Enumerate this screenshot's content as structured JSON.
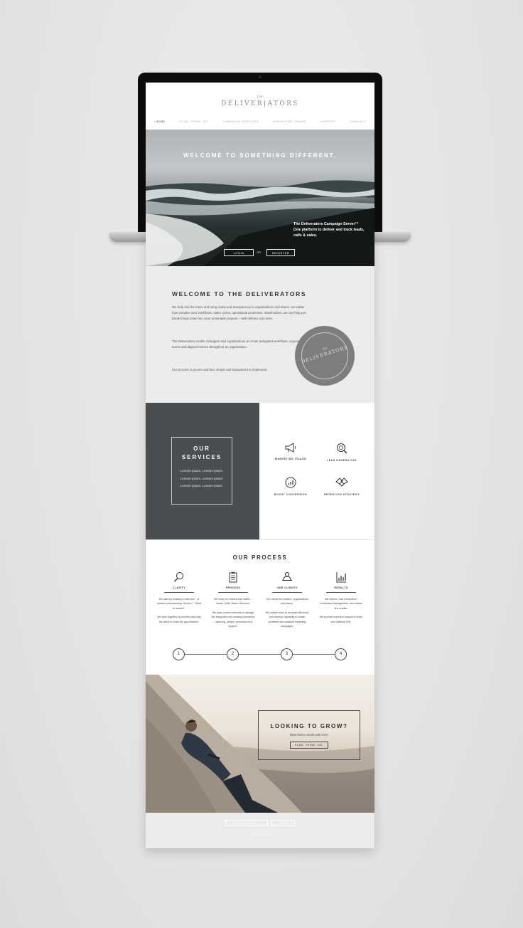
{
  "header": {
    "logo_prefix": "the",
    "logo": "DELIVER|ATORS",
    "nav": [
      "HOME",
      "PLAN. THINK. DO.",
      "CAMPAIGN SERVICES",
      "MARKETING TRIAGE",
      "SUPPORT",
      "CONTACT"
    ],
    "active_nav": "HOME"
  },
  "hero": {
    "title": "WELCOME TO SOMETHING DIFFERENT.",
    "tagline_title": "The Deliverators Campaign Server™",
    "tagline_body": "One platform to deliver and track leads, calls & sales.",
    "login_label": "LOGIN",
    "or_label": "OR",
    "register_label": "REGISTER"
  },
  "welcome": {
    "title": "WELCOME TO THE DELIVERATORS",
    "paragraphs": [
      "We help end the mess and bring clarity and transparency to organisations and teams. No matter how complex your workflows, sales cycles, operational processes, stakeholders, we can help you break things down into clear actionable projects – with defined outcomes.",
      "The Deliverators enable managers and organisations to create delegated workflows, empowered teams and aligned metrics throughout an organisation.",
      "Our process is proven and fast, simple and transparent to implement."
    ],
    "stamp_small": "the",
    "stamp_text": "DELIVERATORS"
  },
  "services": {
    "title_line1": "OUR",
    "title_line2": "SERVICES",
    "body": "Loreum ipsum. Loreum ipsum. Loreum ipsum. Loreum ipsum. Loreum ipsum. Loreum ipsum.",
    "items": [
      {
        "label": "MARKETING TRIAGE",
        "icon": "megaphone-icon"
      },
      {
        "label": "LEAD GENERATION",
        "icon": "target-search-icon"
      },
      {
        "label": "BOOST CONVERSION",
        "icon": "growth-chart-icon"
      },
      {
        "label": "RETENTION STRATEGY",
        "icon": "handshake-icon"
      }
    ]
  },
  "process": {
    "title": "OUR PROCESS",
    "columns": [
      {
        "label": "CLARITY",
        "icon": "magnifier-icon",
        "text1": "We start by creating a base-line – A shared understanding \"What is\", \"What is needed\".",
        "text2": "We work together to prioritise and map the steps to close the gap between."
      },
      {
        "label": "PROCESS",
        "icon": "clipboard-icon",
        "text1": "We focus on metrics that matter – Leads, Calls, Sales, Revenue.",
        "text2": "We have proven methods to manage the integration into existing operations – planning, people, processes and support."
      },
      {
        "label": "OUR CLIENTS",
        "icon": "person-desk-icon",
        "text1": "Our clients are leaders, organisations and teams.",
        "text2": "We enable them to increase efficiency and develop capability to create profitable and scalable marketing campaigns."
      },
      {
        "label": "RESULTS",
        "icon": "bar-chart-icon",
        "text1": "We deliver Lead Generation, Conversion Management, and bottom line results.",
        "text2": "We provide execution support to track and optimise ROI."
      }
    ],
    "steps": [
      "1",
      "2",
      "3",
      "4"
    ]
  },
  "grow": {
    "title": "LOOKING TO GROW?",
    "subtitle": "Want better results with less?",
    "button": "PLAN. THINK. DO."
  },
  "footer": {
    "input_placeholder": "ENTER YOUR EMAIL",
    "button": "SUBMIT",
    "copyright": "© The Deliverators 2016"
  },
  "colors": {
    "dark_panel": "#4a4e53",
    "light_panel": "#ececec",
    "text_dark": "#333333"
  }
}
